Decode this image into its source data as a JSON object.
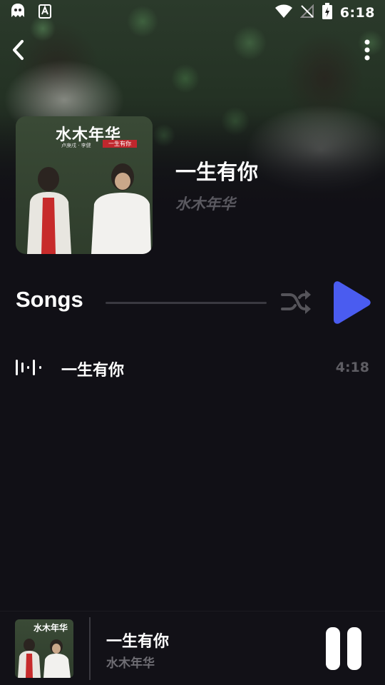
{
  "status_bar": {
    "time": "6:18",
    "icons": [
      "ghost-icon",
      "text-a-icon",
      "wifi-icon",
      "no-signal-icon",
      "battery-charging-icon"
    ]
  },
  "nav": {
    "back_icon": "chevron-left-icon",
    "more_icon": "more-vertical-icon"
  },
  "album": {
    "title": "一生有你",
    "artist": "水木年华",
    "cover_text": "水木年华",
    "cover_subtitle": "卢庚戌 · 李健",
    "cover_tag": "一生有你"
  },
  "songs_section": {
    "heading": "Songs",
    "shuffle_icon": "shuffle-icon",
    "play_icon": "play-icon"
  },
  "tracks": [
    {
      "title": "一生有你",
      "duration": "4:18",
      "playing": true
    }
  ],
  "mini_player": {
    "title": "一生有你",
    "artist": "水木年华",
    "cover_text": "水木年华",
    "state_icon": "pause-icon"
  },
  "colors": {
    "background": "#111016",
    "accent": "#4a5cf0",
    "muted_text": "#5e5d63",
    "divider": "#3a3940"
  }
}
